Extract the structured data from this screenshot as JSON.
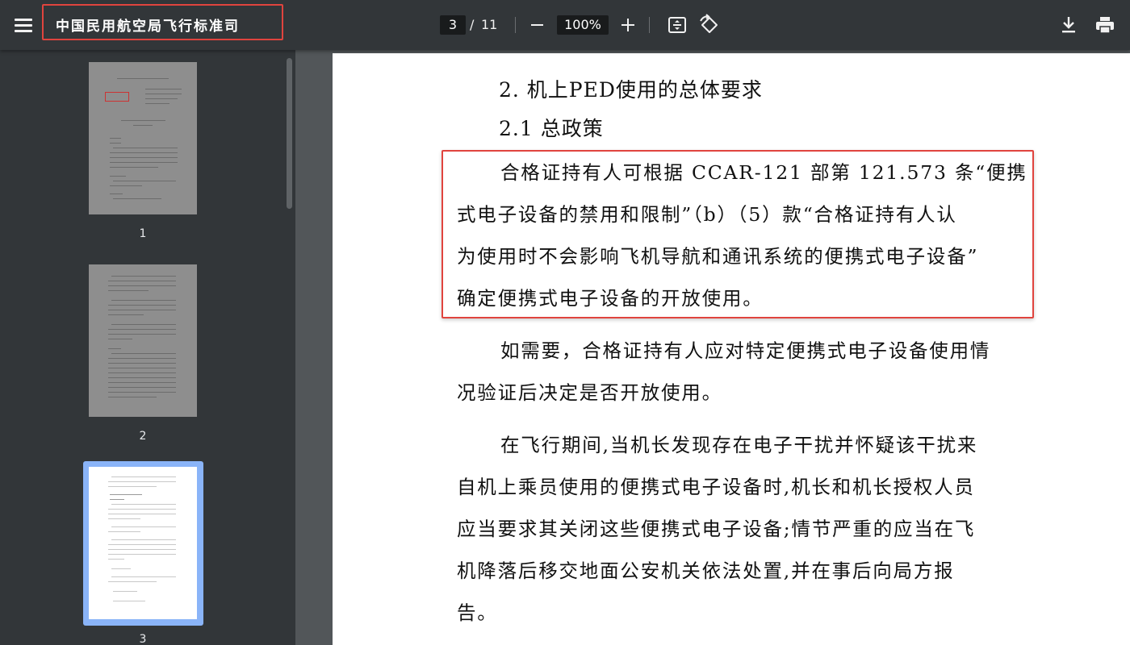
{
  "toolbar": {
    "document_title": "中国民用航空局飞行标准司",
    "current_page": "3",
    "page_separator": "/",
    "total_pages": "11",
    "zoom_level": "100%"
  },
  "sidebar": {
    "thumbnails": [
      {
        "label": "1"
      },
      {
        "label": "2"
      },
      {
        "label": "3"
      }
    ],
    "active_index": 2
  },
  "document": {
    "heading_1": "2. 机上PED使用的总体要求",
    "heading_2": "2.1 总政策",
    "para1": [
      "合格证持有人可根据 CCAR-121 部第 121.573 条“便携",
      "式电子设备的禁用和限制”（b）（5）款“合格证持有人认",
      "为使用时不会影响飞机导航和通讯系统的便携式电子设备”",
      "确定便携式电子设备的开放使用。"
    ],
    "para2": [
      "如需要，合格证持有人应对特定便携式电子设备使用情",
      "况验证后决定是否开放使用。"
    ],
    "para3": [
      "在飞行期间,当机长发现存在电子干扰并怀疑该干扰来",
      "自机上乘员使用的便携式电子设备时,机长和机长授权人员",
      "应当要求其关闭这些便携式电子设备;情节严重的应当在飞",
      "机降落后移交地面公安机关依法处置,并在事后向局方报",
      "告。"
    ]
  },
  "colors": {
    "toolbar_bg": "#323639",
    "viewer_bg": "#525659",
    "annotation_red": "#e0443e",
    "active_thumb_border": "#8ab4f8"
  }
}
